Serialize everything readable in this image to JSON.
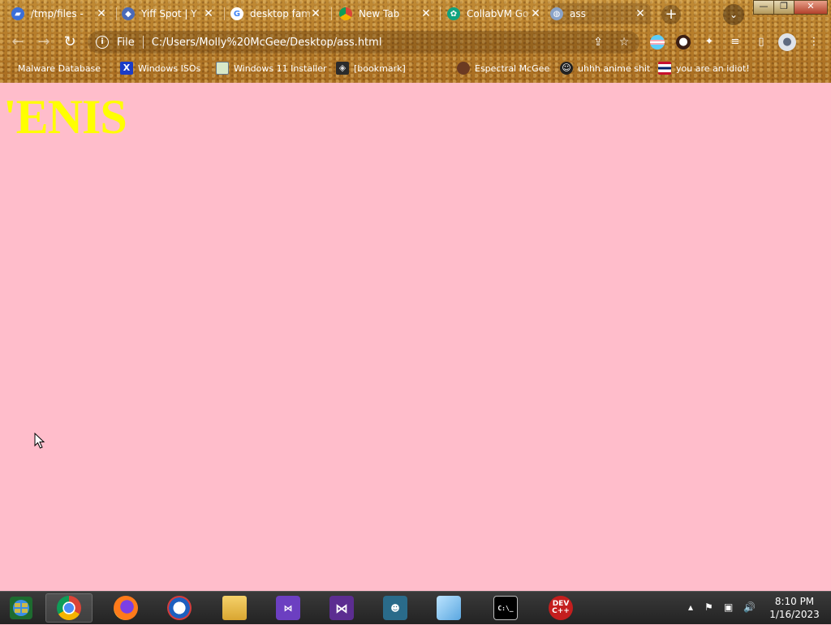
{
  "tabs": [
    {
      "title": "/tmp/files - ",
      "icon": "generic-site-icon"
    },
    {
      "title": "Yiff Spot | Y",
      "icon": "site-icon"
    },
    {
      "title": "desktop fam",
      "icon": "google-icon"
    },
    {
      "title": "New Tab",
      "icon": "chrome-icon"
    },
    {
      "title": "CollabVM Go",
      "icon": "openai-icon"
    },
    {
      "title": "ass",
      "icon": "globe-icon",
      "active": true
    }
  ],
  "new_tab_label": "+",
  "window_controls": {
    "minimize": "—",
    "restore": "❐",
    "close": "✕"
  },
  "address_bar": {
    "scheme": "File",
    "url": "C:/Users/Molly%20McGee/Desktop/ass.html"
  },
  "bookmarks": [
    {
      "label": "Malware Database",
      "icon": "folder-icon"
    },
    {
      "label": "Windows ISOs",
      "icon": "x-icon"
    },
    {
      "label": "Windows 11 Installer",
      "icon": "image-icon"
    },
    {
      "label": "[bookmark]",
      "icon": "site-icon"
    },
    {
      "label": "Espectral McGee",
      "icon": "avatar-icon"
    },
    {
      "label": "uhhh anime shit",
      "icon": "anime-icon"
    },
    {
      "label": "you are an idiot!",
      "icon": "flag-icon"
    }
  ],
  "page": {
    "heading": "'ENIS",
    "background": "#ffbdcb",
    "heading_color": "#ffff00"
  },
  "taskbar": {
    "apps": [
      {
        "name": "chrome",
        "running": true
      },
      {
        "name": "firefox",
        "running": false
      },
      {
        "name": "internet-explorer",
        "running": false
      },
      {
        "name": "file-explorer",
        "running": false
      },
      {
        "name": "visual-studio-installer",
        "running": false
      },
      {
        "name": "visual-studio",
        "running": false
      },
      {
        "name": "people",
        "running": false
      },
      {
        "name": "notepad",
        "running": false
      },
      {
        "name": "command-prompt",
        "running": false
      },
      {
        "name": "dev-cpp",
        "label": "DEV C++",
        "running": false
      }
    ],
    "cmd_label": "C:\\_",
    "time": "8:10 PM",
    "date": "1/16/2023"
  },
  "colors": {
    "chrome_base": "#b77d2a",
    "page_bg": "#ffbdcb",
    "heading": "#ffff00"
  }
}
